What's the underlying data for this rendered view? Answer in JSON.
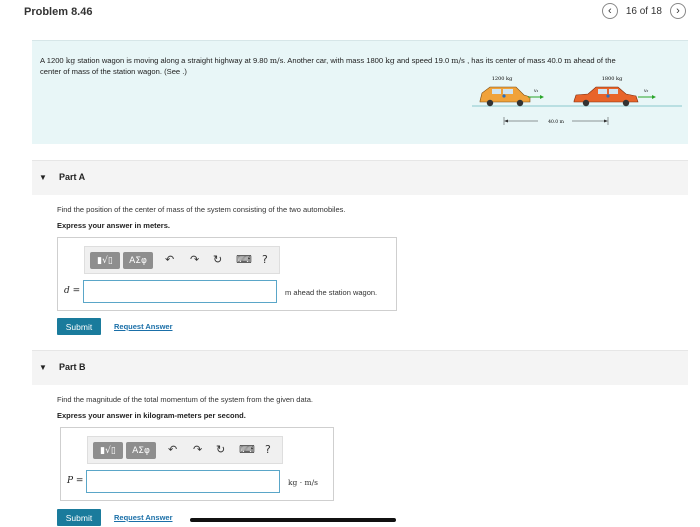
{
  "header": {
    "title": "Problem 8.46",
    "pager": "16 of 18",
    "prev_icon": "‹",
    "next_icon": "›"
  },
  "problem": {
    "text_parts": [
      "A 1200 ",
      "kg",
      " station wagon is moving along a straight highway at 9.80 ",
      "m/s",
      ". Another car, with mass 1800 ",
      "kg",
      " and speed 19.0 ",
      "m/s",
      " , has its center of mass 40.0 ",
      "m",
      " ahead of the",
      "center of mass of the station wagon. (See .)"
    ],
    "figure": {
      "left_mass": "1200 kg",
      "right_mass": "1800 kg",
      "distance": "40.0 m",
      "v1": "v₁",
      "v2": "v₂"
    }
  },
  "partA": {
    "label": "Part A",
    "question": "Find the position of the center of mass of the system consisting of the two automobiles.",
    "instruction": "Express your answer in meters.",
    "var": "d =",
    "unit": "m ahead the station wagon.",
    "submit": "Submit",
    "request": "Request Answer"
  },
  "partB": {
    "label": "Part B",
    "question": "Find the magnitude of the total momentum of the system from the given data.",
    "instruction": "Express your answer in kilogram-meters per second.",
    "var": "P =",
    "unit": "kg · m/s",
    "submit": "Submit",
    "request": "Request Answer"
  },
  "toolbar": {
    "templates": "▮√▯",
    "greek": "ΑΣφ",
    "undo": "↶",
    "redo": "↷",
    "reset": "↻",
    "keyboard": "⌨",
    "help": "?"
  },
  "colors": {
    "accent": "#1a7b9c",
    "link": "#1a6fa8",
    "problem_bg": "#e8f6f7",
    "car": "#e8642a"
  }
}
